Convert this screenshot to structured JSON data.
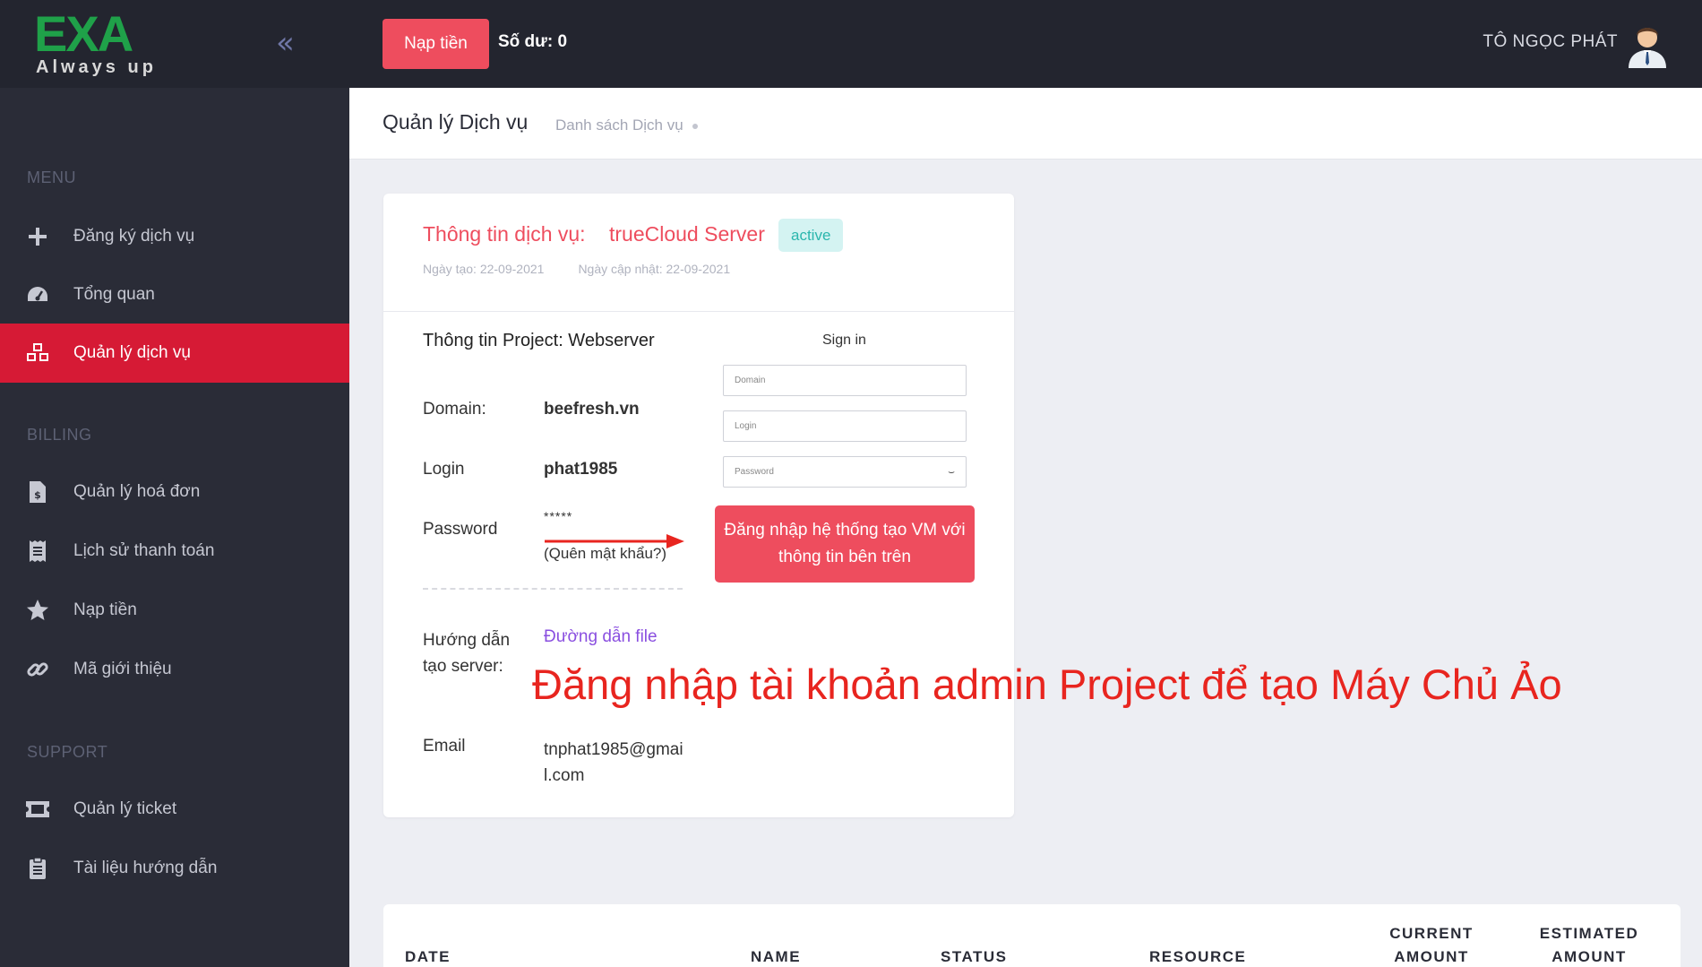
{
  "brand": {
    "logo_text": "EXA",
    "logo_tagline": "Always up"
  },
  "sidebar": {
    "sections": {
      "menu": "MENU",
      "billing": "BILLING",
      "support": "SUPPORT"
    },
    "items": [
      {
        "label": "Đăng ký dịch vụ",
        "icon": "plus-icon"
      },
      {
        "label": "Tổng quan",
        "icon": "dashboard-gauge-icon"
      },
      {
        "label": "Quản lý dịch vụ",
        "icon": "cubes-icon",
        "active": true
      },
      {
        "label": "Quản lý hoá đơn",
        "icon": "invoice-icon"
      },
      {
        "label": "Lịch sử thanh toán",
        "icon": "receipt-icon"
      },
      {
        "label": "Nạp tiền",
        "icon": "star-icon"
      },
      {
        "label": "Mã giới thiệu",
        "icon": "link-icon"
      },
      {
        "label": "Quản lý ticket",
        "icon": "ticket-icon"
      },
      {
        "label": "Tài liệu hướng dẫn",
        "icon": "clipboard-icon"
      }
    ]
  },
  "topbar": {
    "deposit_button": "Nạp tiền",
    "balance": "Số dư: 0",
    "user_name": "TÔ NGỌC PHÁT"
  },
  "page": {
    "title": "Quản lý Dịch vụ",
    "breadcrumb": "Danh sách Dịch vụ"
  },
  "service": {
    "label": "Thông tin dịch vụ:",
    "name": "trueCloud Server",
    "status": "active",
    "created": "Ngày tạo: 22-09-2021",
    "updated": "Ngày cập nhật: 22-09-2021"
  },
  "project": {
    "title": "Thông tin Project: Webserver",
    "domain_label": "Domain:",
    "domain_value": "beefresh.vn",
    "login_label": "Login",
    "login_value": "phat1985",
    "password_label": "Password",
    "password_value": "*****",
    "forgot_password": "(Quên mật khẩu?)",
    "guide_label": "Hướng dẫn tạo server:",
    "guide_link": "Đường dẫn file",
    "email_label": "Email",
    "email_value": "tnphat1985@gmail.com"
  },
  "signin": {
    "title": "Sign in",
    "domain_placeholder": "Domain",
    "login_placeholder": "Login",
    "password_placeholder": "Password",
    "button": "Đăng nhập hệ thống tạo VM với thông tin bên trên"
  },
  "annotation": {
    "text": "Đăng nhập tài khoản admin Project để tạo Máy Chủ Ảo",
    "color": "#e8251f"
  },
  "table": {
    "headers": [
      "DATE",
      "NAME",
      "STATUS",
      "RESOURCE",
      "CURRENT AMOUNT",
      "ESTIMATED AMOUNT"
    ]
  },
  "colors": {
    "accent": "#ee4d5e",
    "active_nav": "#d61a35",
    "sidebar_bg": "#2a2c37",
    "badge_text": "#2bb6ad"
  }
}
